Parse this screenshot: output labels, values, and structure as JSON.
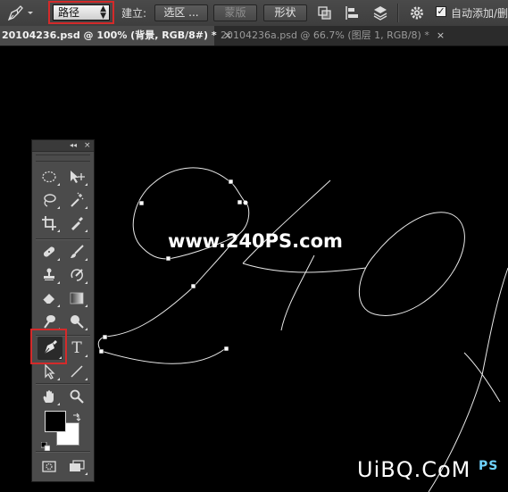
{
  "options_bar": {
    "mode_select_value": "路径",
    "make_label": "建立:",
    "selection_button": "选区 ...",
    "mask_button": "蒙版",
    "shape_button": "形状",
    "auto_add_delete_label": "自动添加/删",
    "auto_add_delete_checked": true
  },
  "tabs": [
    {
      "title": "20104236.psd @ 100% (背景, RGB/8#) *",
      "close": "×"
    },
    {
      "title": "20104236a.psd @ 66.7% (图层 1, RGB/8) *",
      "close": "×"
    }
  ],
  "canvas": {
    "watermark": "www.240PS.com",
    "logo_text": "UiBQ.CoM",
    "logo_sub": "PS"
  },
  "tools_panel": {
    "collapse": "◂◂",
    "close": "×",
    "type_tool_glyph": "T",
    "highlighted_tool": "pen-tool"
  },
  "colors": {
    "highlight": "#d42a2a",
    "panel_bg": "#4b4b4b",
    "options_bar_bg": "#434343",
    "canvas_bg": "#000000",
    "foreground_color": "#000000",
    "background_color": "#ffffff"
  },
  "icons": [
    "pen-icon",
    "marquee-icon",
    "move-icon",
    "lasso-icon",
    "magic-wand-icon",
    "crop-icon",
    "eyedropper-icon",
    "healing-brush-icon",
    "brush-icon",
    "clone-stamp-icon",
    "history-brush-icon",
    "eraser-icon",
    "gradient-icon",
    "smudge-icon",
    "dodge-icon",
    "pen-tool-icon",
    "type-tool-icon",
    "path-selection-icon",
    "line-icon",
    "hand-icon",
    "zoom-icon",
    "quick-mask-icon",
    "screen-mode-icon",
    "gear-icon"
  ]
}
